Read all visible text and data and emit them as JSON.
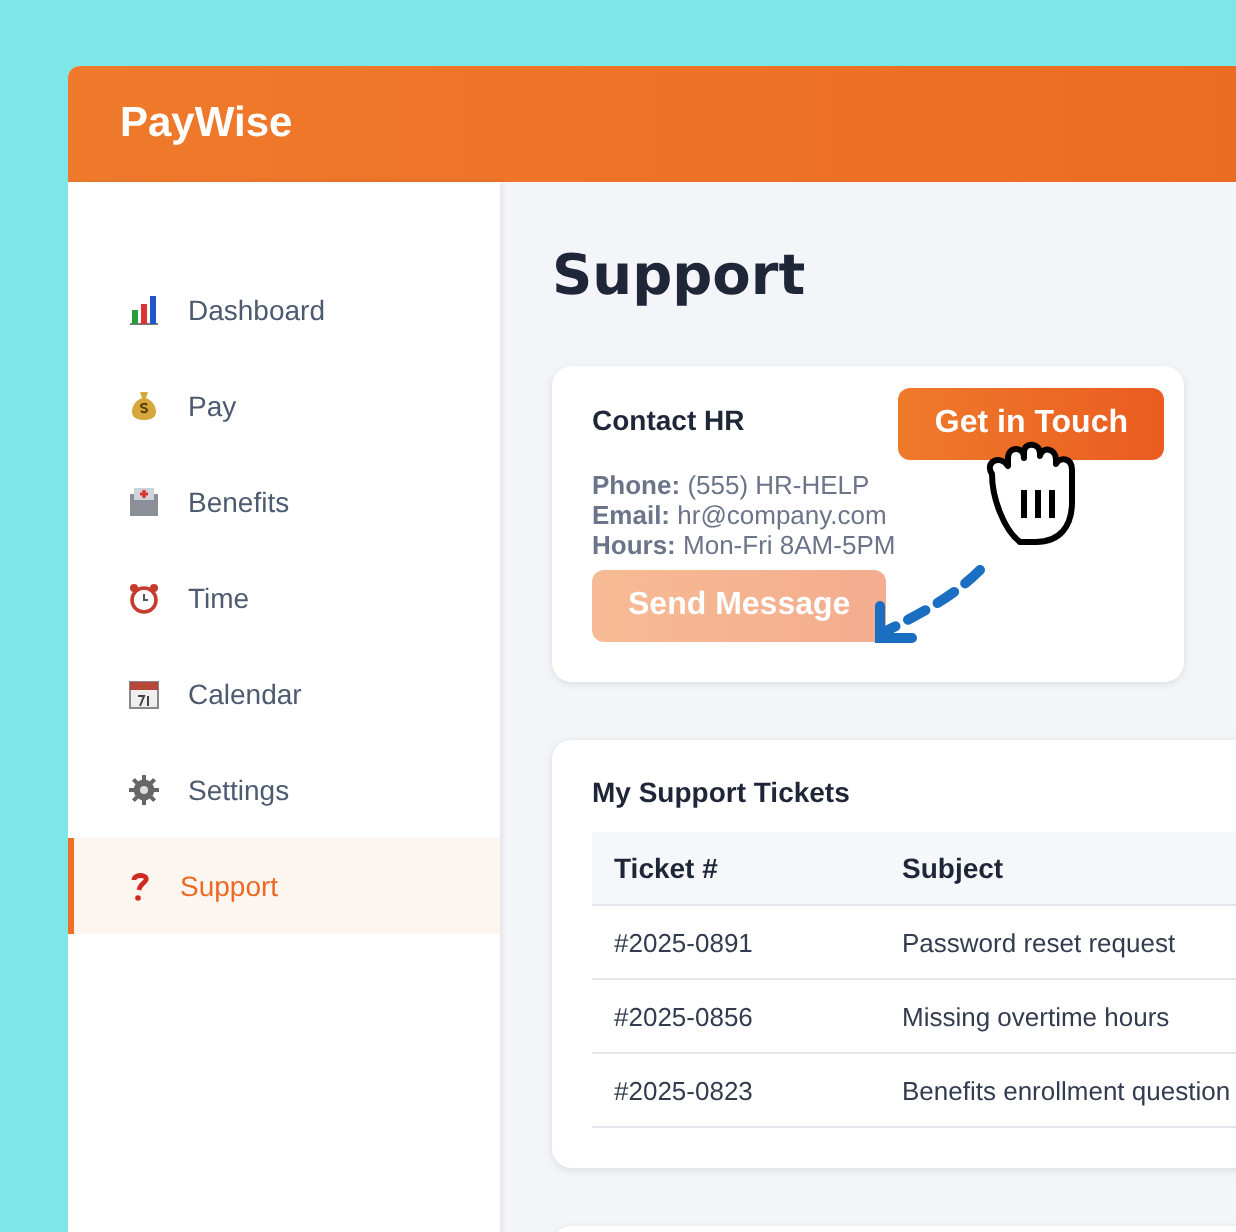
{
  "app": {
    "title": "PayWise"
  },
  "sidebar": {
    "items": [
      {
        "label": "Dashboard",
        "selected": false
      },
      {
        "label": "Pay",
        "selected": false
      },
      {
        "label": "Benefits",
        "selected": false
      },
      {
        "label": "Time",
        "selected": false
      },
      {
        "label": "Calendar",
        "selected": false
      },
      {
        "label": "Settings",
        "selected": false
      },
      {
        "label": "Support",
        "selected": true
      }
    ]
  },
  "page_title": "Support",
  "contact": {
    "title": "Contact HR",
    "primary_button": "Get in Touch",
    "lines": [
      {
        "label": "Phone:",
        "value": "(555) HR-HELP"
      },
      {
        "label": "Email:",
        "value": "hr@company.com"
      },
      {
        "label": "Hours:",
        "value": "Mon-Fri 8AM-5PM"
      }
    ],
    "secondary_button": {
      "label": "Send Message",
      "disabled": true
    }
  },
  "tickets": {
    "title": "My Support Tickets",
    "columns": [
      "Ticket #",
      "Subject"
    ],
    "rows": [
      [
        "#2025-0891",
        "Password reset request"
      ],
      [
        "#2025-0856",
        "Missing overtime hours"
      ],
      [
        "#2025-0823",
        "Benefits enrollment question"
      ]
    ]
  }
}
